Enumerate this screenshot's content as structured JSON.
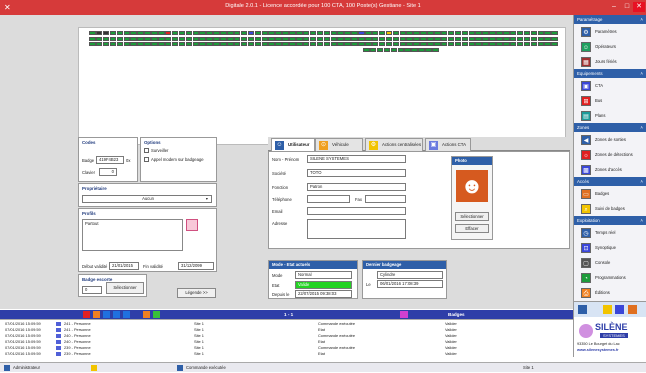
{
  "title": {
    "text": "Digitale 2.0.1 - Licence accordée pour 100 CTA, 100 Poste(s) Gestiane - Site 1",
    "min": "–",
    "max": "□",
    "close": "✕",
    "logo": "✕"
  },
  "colors": {
    "accent": "#2e5fa8",
    "title": "#d63a3a",
    "active": "#1d9b3b",
    "alarm": "#e02020",
    "info": "#3a46d8",
    "warn": "#f2c400",
    "dark": "#333333"
  },
  "plan_rows": [
    [
      "a",
      "d",
      "d",
      "a",
      "a",
      "a",
      "a",
      "a",
      "a",
      "a",
      "a",
      "r",
      "a",
      "a",
      "a",
      "a",
      "a",
      "a",
      "a",
      "a",
      "a",
      "a",
      "a",
      "b",
      "a",
      "a",
      "a",
      "a",
      "a",
      "a",
      "a",
      "a",
      "a",
      "a",
      "a",
      "a",
      "a",
      "a",
      "a",
      "b",
      "a",
      "a",
      "a",
      "y",
      "a",
      "a",
      "a",
      "a",
      "a",
      "a",
      "a",
      "a",
      "a",
      "a",
      "a",
      "a",
      "a",
      "a",
      "a",
      "a",
      "a",
      "a",
      "a",
      "a",
      "a",
      "a",
      "a",
      "a"
    ],
    [
      "a",
      "a",
      "a",
      "a",
      "a",
      "a",
      "a",
      "a",
      "a",
      "a",
      "a",
      "a",
      "a",
      "a",
      "a",
      "a",
      "a",
      "a",
      "a",
      "a",
      "a",
      "a",
      "a",
      "a",
      "a",
      "a",
      "a",
      "a",
      "a",
      "a",
      "a",
      "a",
      "a",
      "a",
      "a",
      "a",
      "a",
      "a",
      "a",
      "a",
      "a",
      "a",
      "a",
      "a",
      "a",
      "a",
      "a",
      "a",
      "a",
      "a",
      "a",
      "a",
      "a",
      "a",
      "a",
      "a",
      "a",
      "a",
      "a",
      "a",
      "a",
      "a",
      "a",
      "a",
      "a",
      "a",
      "a",
      "a"
    ],
    [
      "a",
      "a",
      "a",
      "a",
      "a",
      "a",
      "a",
      "a",
      "a",
      "a",
      "a",
      "a",
      "a",
      "a",
      "a",
      "a",
      "a",
      "a",
      "a",
      "a",
      "a",
      "a",
      "a",
      "a",
      "a",
      "a",
      "a",
      "a",
      "a",
      "a",
      "a",
      "a",
      "a",
      "a",
      "a",
      "a",
      "a",
      "a",
      "a",
      "a",
      "a",
      "a",
      "a",
      "a",
      "a",
      "a",
      "a",
      "a",
      "a",
      "a",
      "a",
      "a",
      "a",
      "a",
      "a",
      "a",
      "a",
      "a",
      "a",
      "a",
      "a",
      "a",
      "a",
      "a",
      "a",
      "a",
      "a",
      "a"
    ]
  ],
  "plan_short": [
    "a",
    "a",
    "a",
    "a",
    "a",
    "a",
    "a",
    "a",
    "a",
    "a",
    "a"
  ],
  "codes": {
    "title": "Codes",
    "badge_label": "Badge",
    "badge_value": "419F4B23",
    "badge_unit": "0x",
    "clavier_label": "Clavier",
    "clavier_value": "0"
  },
  "options": {
    "title": "Options",
    "surveiller": "Surveiller",
    "appel": "Appel modem sur badgeage"
  },
  "proprietaire": {
    "title": "Propriétaire",
    "value": "Aucun",
    "arrow": "▾"
  },
  "profils": {
    "title": "Profils",
    "item": "Partout"
  },
  "validite": {
    "debut_label": "Début validité",
    "debut_value": "21/01/2015",
    "fin_label": "Fin validité",
    "fin_value": "31/12/2099"
  },
  "escorte": {
    "title": "Badge escorte",
    "value": "0",
    "select_btn": "Sélectionner",
    "legend_btn": "Légende >>"
  },
  "tabs": [
    {
      "label": "Utilisateur"
    },
    {
      "label": "Véhicule"
    },
    {
      "label": "Actions centralisées"
    },
    {
      "label": "Actions CTA"
    }
  ],
  "user": {
    "nom_label": "Nom - Prénom",
    "nom_value": "SILENE SYSTEMES",
    "societe_label": "Société",
    "societe_value": "TOTO",
    "fonction_label": "Fonction",
    "fonction_value": "Patron",
    "telephone_label": "Téléphone",
    "fax_label": "Fax",
    "email_label": "Email",
    "adresse_label": "Adresse",
    "photo_title": "Photo",
    "select_btn": "Sélectionner",
    "erase_btn": "Effacer"
  },
  "mode": {
    "title": "Mode - Etat actuels",
    "mode_label": "Mode",
    "mode_value": "Normal",
    "etat_label": "Etat",
    "etat_value": "Valide",
    "depuis_label": "Depuis le",
    "depuis_value": "22/07/2015 09:38:03"
  },
  "dernier": {
    "title": "Dernier badgeage",
    "lieu_value": "Cylindre",
    "le_label": "Le",
    "le_value": "06/01/2016 17:08:39"
  },
  "bottombar": {
    "page": "1 - 1",
    "badges": "Badges"
  },
  "log": [
    {
      "time": "07/01/2016 15:09:59",
      "name": "241 - Personne",
      "site": "Site 1",
      "action": "Commande exécutée",
      "state": "Valider"
    },
    {
      "time": "07/01/2016 15:09:59",
      "name": "241 - Personne",
      "site": "Site 1",
      "action": "Etat",
      "state": "Valider"
    },
    {
      "time": "07/01/2016 15:09:59",
      "name": "240 - Personne",
      "site": "Site 1",
      "action": "Commande exécutée",
      "state": "Valider"
    },
    {
      "time": "07/01/2016 15:09:59",
      "name": "240 - Personne",
      "site": "Site 1",
      "action": "Etat",
      "state": "Valider"
    },
    {
      "time": "07/01/2016 15:09:59",
      "name": "239 - Personne",
      "site": "Site 1",
      "action": "Commande exécutée",
      "state": "Valider"
    },
    {
      "time": "07/01/2016 15:09:59",
      "name": "239 - Personne",
      "site": "Site 1",
      "action": "Etat",
      "state": "Valider"
    }
  ],
  "sidebar": {
    "param_title": "Paramétrage",
    "parametres": "Paramètres",
    "operateurs": "Opérateurs",
    "jours": "Jours fériés",
    "equip_title": "Equipements",
    "cta": "CTA",
    "bus": "Bus",
    "plans": "Plans",
    "zones_title": "Zones",
    "zones_sorties": "Zones de sorties",
    "zones_detections": "Zones de détections",
    "zones_acces": "Zones d'accès",
    "acces_title": "Accès",
    "badges": "Badges",
    "suivi": "Suivi de badges",
    "exploit_title": "Exploitation",
    "temps": "Temps réel",
    "synoptique": "Synoptique",
    "console": "Console",
    "programmations": "Programmations",
    "editions": "Éditions",
    "caret": "˄"
  },
  "silene": {
    "name": "SILÈNE",
    "sub": "SYSTEMES",
    "addr": "93350 Le Bourget du Lac",
    "web": "www.silenesystemes.fr"
  },
  "status": {
    "user": "Administrateur",
    "cmd": "Commande exécutée",
    "site": "Site 1"
  }
}
